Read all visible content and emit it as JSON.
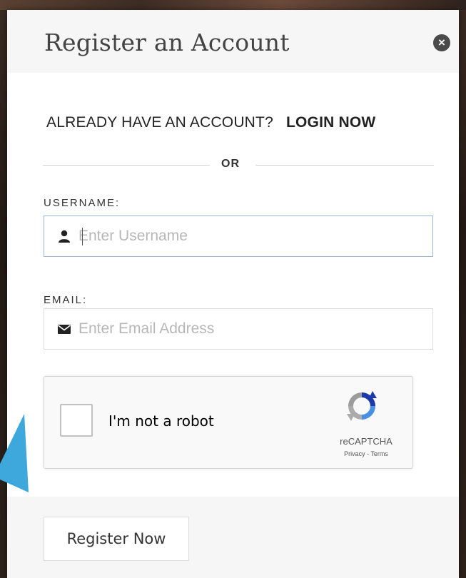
{
  "modal": {
    "title": "Register an Account",
    "close_icon": "close-circle-icon"
  },
  "login_prompt": {
    "text": "ALREADY HAVE AN ACCOUNT?",
    "link_label": "LOGIN NOW"
  },
  "divider": {
    "text": "OR"
  },
  "form": {
    "username": {
      "label": "USERNAME:",
      "placeholder": "Enter Username",
      "value": "",
      "icon": "user-icon"
    },
    "email": {
      "label": "EMAIL:",
      "placeholder": "Enter Email Address",
      "value": "",
      "icon": "envelope-icon"
    }
  },
  "captcha": {
    "label": "I'm not a robot",
    "brand": "reCAPTCHA",
    "privacy_label": "Privacy",
    "separator": " - ",
    "terms_label": "Terms",
    "logo_icon": "recaptcha-logo-icon"
  },
  "footer": {
    "register_label": "Register Now"
  },
  "colors": {
    "accent_arrow": "#3ea8dc",
    "header_bg": "#f6f6f6",
    "focus_border": "#9ab7d6"
  }
}
